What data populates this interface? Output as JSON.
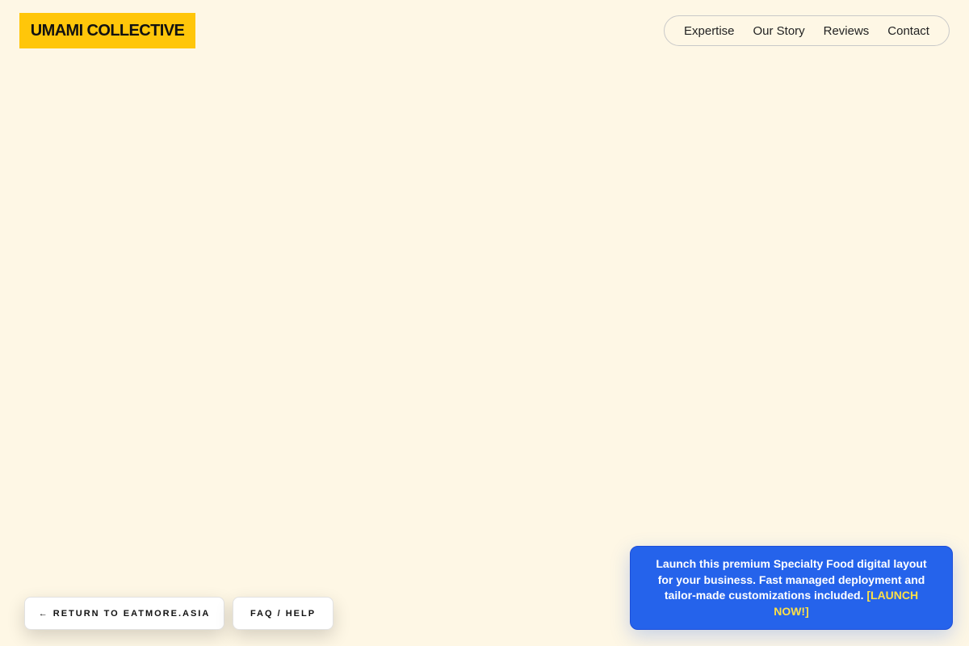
{
  "header": {
    "logo_text": "UMAMI COLLECTIVE",
    "nav": [
      {
        "label": "Expertise"
      },
      {
        "label": "Our Story"
      },
      {
        "label": "Reviews"
      },
      {
        "label": "Contact"
      }
    ]
  },
  "footer_actions": {
    "return_label": "← RETURN TO EATMORE.ASIA",
    "faq_label": "FAQ / HELP"
  },
  "promo": {
    "text": "Launch this premium Specialty Food digital layout for your business. Fast managed deployment and tailor-made customizations included.",
    "cta_label": "[LAUNCH NOW!]"
  },
  "colors": {
    "background": "#FEF7E5",
    "logo_bg": "#FFC60A",
    "promo_bg": "#2563EB",
    "promo_cta": "#FDE047"
  }
}
